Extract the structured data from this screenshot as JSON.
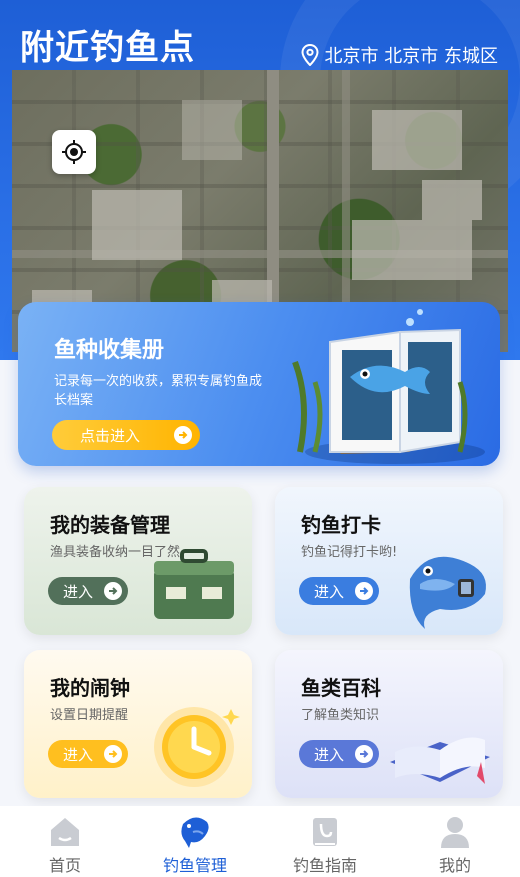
{
  "header": {
    "title": "附近钓鱼点",
    "location": "北京市 北京市 东城区"
  },
  "map": {
    "locate_icon": "crosshair-icon"
  },
  "collection": {
    "title": "鱼种收集册",
    "desc": "记录每一次的收获，累积专属钓鱼成长档案",
    "button": "点击进入"
  },
  "cards": [
    {
      "title": "我的装备管理",
      "sub": "渔具装备收纳一目了然",
      "button": "进入",
      "btn_color": "#52705a"
    },
    {
      "title": "钓鱼打卡",
      "sub": "钓鱼记得打卡哟!",
      "button": "进入",
      "btn_color": "#3a7de0"
    },
    {
      "title": "我的闹钟",
      "sub": "设置日期提醒",
      "button": "进入",
      "btn_color": "#ffbf1f"
    },
    {
      "title": "鱼类百科",
      "sub": "了解鱼类知识",
      "button": "进入",
      "btn_color": "#5a78d8"
    }
  ],
  "tabbar": {
    "items": [
      {
        "label": "首页",
        "icon": "home-icon"
      },
      {
        "label": "钓鱼管理",
        "icon": "fish-icon"
      },
      {
        "label": "钓鱼指南",
        "icon": "guide-book-icon"
      },
      {
        "label": "我的",
        "icon": "user-icon"
      }
    ],
    "active_color": "#1e5fd6"
  }
}
